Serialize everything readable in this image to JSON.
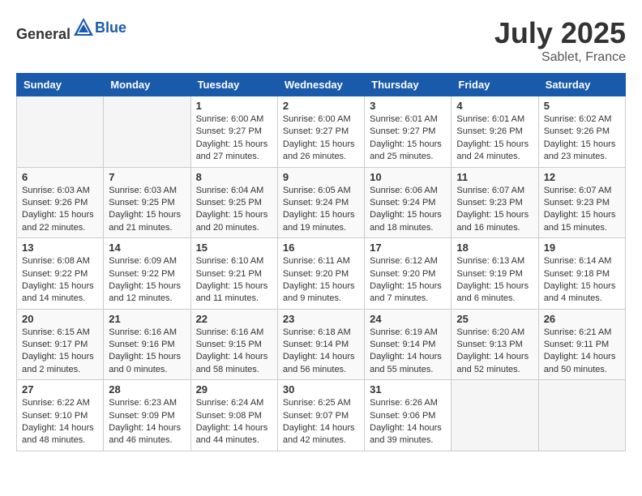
{
  "header": {
    "logo_general": "General",
    "logo_blue": "Blue",
    "month_year": "July 2025",
    "location": "Sablet, France"
  },
  "weekdays": [
    "Sunday",
    "Monday",
    "Tuesday",
    "Wednesday",
    "Thursday",
    "Friday",
    "Saturday"
  ],
  "weeks": [
    [
      {
        "day": "",
        "info": ""
      },
      {
        "day": "",
        "info": ""
      },
      {
        "day": "1",
        "info": "Sunrise: 6:00 AM\nSunset: 9:27 PM\nDaylight: 15 hours and 27 minutes."
      },
      {
        "day": "2",
        "info": "Sunrise: 6:00 AM\nSunset: 9:27 PM\nDaylight: 15 hours and 26 minutes."
      },
      {
        "day": "3",
        "info": "Sunrise: 6:01 AM\nSunset: 9:27 PM\nDaylight: 15 hours and 25 minutes."
      },
      {
        "day": "4",
        "info": "Sunrise: 6:01 AM\nSunset: 9:26 PM\nDaylight: 15 hours and 24 minutes."
      },
      {
        "day": "5",
        "info": "Sunrise: 6:02 AM\nSunset: 9:26 PM\nDaylight: 15 hours and 23 minutes."
      }
    ],
    [
      {
        "day": "6",
        "info": "Sunrise: 6:03 AM\nSunset: 9:26 PM\nDaylight: 15 hours and 22 minutes."
      },
      {
        "day": "7",
        "info": "Sunrise: 6:03 AM\nSunset: 9:25 PM\nDaylight: 15 hours and 21 minutes."
      },
      {
        "day": "8",
        "info": "Sunrise: 6:04 AM\nSunset: 9:25 PM\nDaylight: 15 hours and 20 minutes."
      },
      {
        "day": "9",
        "info": "Sunrise: 6:05 AM\nSunset: 9:24 PM\nDaylight: 15 hours and 19 minutes."
      },
      {
        "day": "10",
        "info": "Sunrise: 6:06 AM\nSunset: 9:24 PM\nDaylight: 15 hours and 18 minutes."
      },
      {
        "day": "11",
        "info": "Sunrise: 6:07 AM\nSunset: 9:23 PM\nDaylight: 15 hours and 16 minutes."
      },
      {
        "day": "12",
        "info": "Sunrise: 6:07 AM\nSunset: 9:23 PM\nDaylight: 15 hours and 15 minutes."
      }
    ],
    [
      {
        "day": "13",
        "info": "Sunrise: 6:08 AM\nSunset: 9:22 PM\nDaylight: 15 hours and 14 minutes."
      },
      {
        "day": "14",
        "info": "Sunrise: 6:09 AM\nSunset: 9:22 PM\nDaylight: 15 hours and 12 minutes."
      },
      {
        "day": "15",
        "info": "Sunrise: 6:10 AM\nSunset: 9:21 PM\nDaylight: 15 hours and 11 minutes."
      },
      {
        "day": "16",
        "info": "Sunrise: 6:11 AM\nSunset: 9:20 PM\nDaylight: 15 hours and 9 minutes."
      },
      {
        "day": "17",
        "info": "Sunrise: 6:12 AM\nSunset: 9:20 PM\nDaylight: 15 hours and 7 minutes."
      },
      {
        "day": "18",
        "info": "Sunrise: 6:13 AM\nSunset: 9:19 PM\nDaylight: 15 hours and 6 minutes."
      },
      {
        "day": "19",
        "info": "Sunrise: 6:14 AM\nSunset: 9:18 PM\nDaylight: 15 hours and 4 minutes."
      }
    ],
    [
      {
        "day": "20",
        "info": "Sunrise: 6:15 AM\nSunset: 9:17 PM\nDaylight: 15 hours and 2 minutes."
      },
      {
        "day": "21",
        "info": "Sunrise: 6:16 AM\nSunset: 9:16 PM\nDaylight: 15 hours and 0 minutes."
      },
      {
        "day": "22",
        "info": "Sunrise: 6:16 AM\nSunset: 9:15 PM\nDaylight: 14 hours and 58 minutes."
      },
      {
        "day": "23",
        "info": "Sunrise: 6:18 AM\nSunset: 9:14 PM\nDaylight: 14 hours and 56 minutes."
      },
      {
        "day": "24",
        "info": "Sunrise: 6:19 AM\nSunset: 9:14 PM\nDaylight: 14 hours and 55 minutes."
      },
      {
        "day": "25",
        "info": "Sunrise: 6:20 AM\nSunset: 9:13 PM\nDaylight: 14 hours and 52 minutes."
      },
      {
        "day": "26",
        "info": "Sunrise: 6:21 AM\nSunset: 9:11 PM\nDaylight: 14 hours and 50 minutes."
      }
    ],
    [
      {
        "day": "27",
        "info": "Sunrise: 6:22 AM\nSunset: 9:10 PM\nDaylight: 14 hours and 48 minutes."
      },
      {
        "day": "28",
        "info": "Sunrise: 6:23 AM\nSunset: 9:09 PM\nDaylight: 14 hours and 46 minutes."
      },
      {
        "day": "29",
        "info": "Sunrise: 6:24 AM\nSunset: 9:08 PM\nDaylight: 14 hours and 44 minutes."
      },
      {
        "day": "30",
        "info": "Sunrise: 6:25 AM\nSunset: 9:07 PM\nDaylight: 14 hours and 42 minutes."
      },
      {
        "day": "31",
        "info": "Sunrise: 6:26 AM\nSunset: 9:06 PM\nDaylight: 14 hours and 39 minutes."
      },
      {
        "day": "",
        "info": ""
      },
      {
        "day": "",
        "info": ""
      }
    ]
  ]
}
